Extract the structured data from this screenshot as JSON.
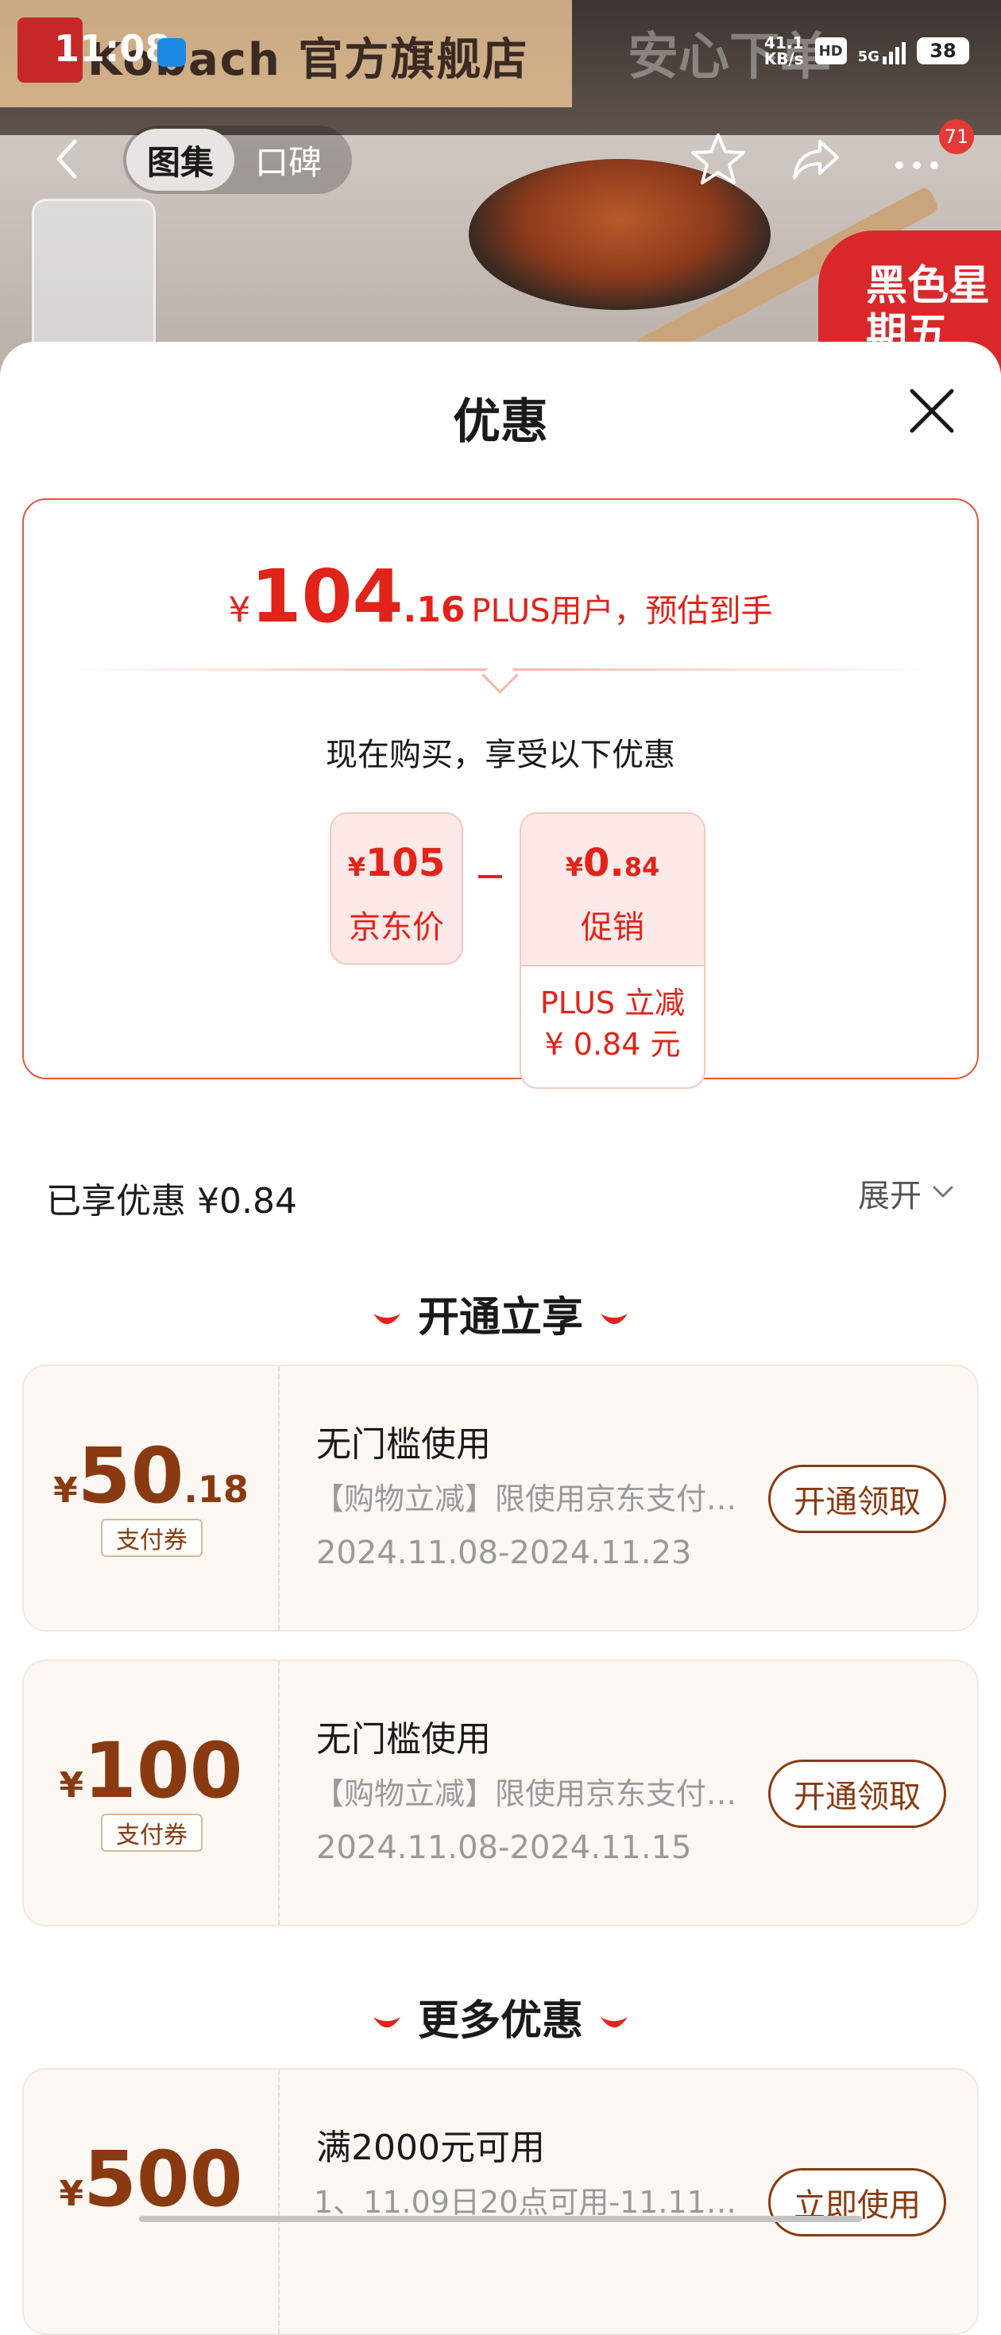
{
  "status_bar": {
    "time": "11:08",
    "net_speed_value": "41.1",
    "net_speed_unit": "KB/s",
    "hd": "HD",
    "network": "5G",
    "battery": "38"
  },
  "background": {
    "store_name": "Kobach 官方旗舰店",
    "store_slogan": "安心下单",
    "promo_badge": "黑色星期五"
  },
  "nav": {
    "tabs": [
      {
        "label": "图集"
      },
      {
        "label": "口碑"
      }
    ],
    "more_badge": "71"
  },
  "sheet": {
    "title": "优惠"
  },
  "price_card": {
    "currency": "¥",
    "integer": "104",
    "decimal": ".16",
    "label": "PLUS用户，预估到手",
    "buy_text": "现在购买，享受以下优惠",
    "jd_price": {
      "currency": "¥",
      "amount": "105",
      "label": "京东价"
    },
    "promo": {
      "currency": "¥",
      "amount": "0.",
      "decimal": "84",
      "label": "促销",
      "detail_line1": "PLUS 立减",
      "detail_line2": "¥ 0.84 元"
    }
  },
  "enjoyed": {
    "text": "已享优惠 ¥0.84",
    "expand_label": "展开"
  },
  "sections": {
    "open_now": "开通立享",
    "more_offers": "更多优惠"
  },
  "coupons": [
    {
      "currency": "¥",
      "integer": "50",
      "decimal": ".18",
      "tag": "支付券",
      "title": "无门槛使用",
      "desc": "【购物立减】限使用京东支付…",
      "date": "2024.11.08-2024.11.23",
      "button": "开通领取"
    },
    {
      "currency": "¥",
      "integer": "100",
      "decimal": "",
      "tag": "支付券",
      "title": "无门槛使用",
      "desc": "【购物立减】限使用京东支付…",
      "date": "2024.11.08-2024.11.15",
      "button": "开通领取"
    },
    {
      "currency": "¥",
      "integer": "500",
      "decimal": "",
      "tag": "",
      "title": "满2000元可用",
      "desc": "1、11.09日20点可用-11.11…",
      "date": "",
      "button": "立即使用"
    }
  ],
  "colors": {
    "accent_red": "#e2231a",
    "coupon_brown": "#8a3a10",
    "coupon_bg": "#fdf8f3"
  }
}
